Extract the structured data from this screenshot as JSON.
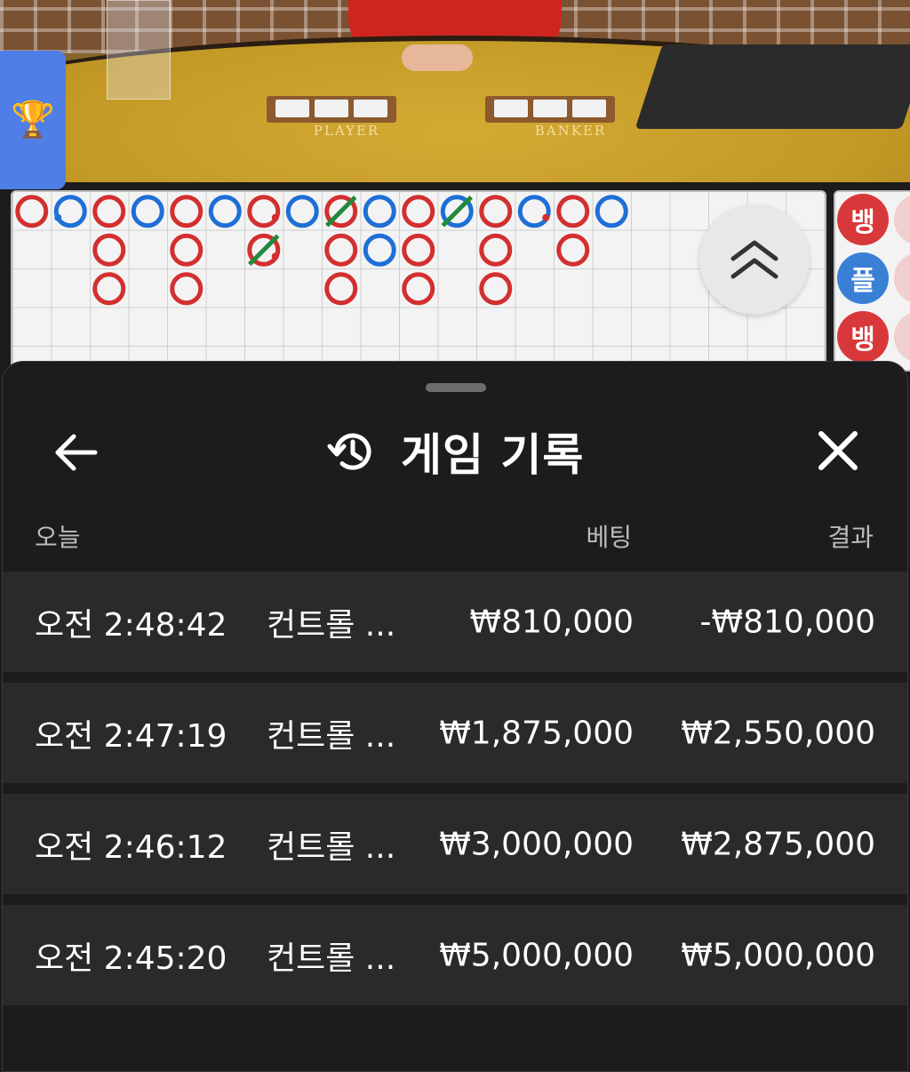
{
  "video": {
    "felt_labels": {
      "player": "PLAYER",
      "banker": "BANKER"
    }
  },
  "scoreboard": {
    "bead_road_labels": [
      "뱅",
      "플",
      "뱅"
    ],
    "colors": {
      "banker": "#d32f2f",
      "player": "#1e6fd6",
      "tie": "#1f8a3b"
    },
    "big_road": [
      {
        "col": 0,
        "row": 0,
        "side": "B"
      },
      {
        "col": 1,
        "row": 0,
        "side": "P",
        "mark": "dot-left"
      },
      {
        "col": 2,
        "row": 0,
        "side": "B"
      },
      {
        "col": 2,
        "row": 1,
        "side": "B"
      },
      {
        "col": 2,
        "row": 2,
        "side": "B"
      },
      {
        "col": 3,
        "row": 0,
        "side": "P"
      },
      {
        "col": 4,
        "row": 0,
        "side": "B"
      },
      {
        "col": 4,
        "row": 1,
        "side": "B"
      },
      {
        "col": 4,
        "row": 2,
        "side": "B"
      },
      {
        "col": 5,
        "row": 0,
        "side": "P"
      },
      {
        "col": 6,
        "row": 0,
        "side": "B",
        "mark": "dot-right"
      },
      {
        "col": 6,
        "row": 1,
        "side": "B",
        "mark": "tie-dot"
      },
      {
        "col": 7,
        "row": 0,
        "side": "P"
      },
      {
        "col": 8,
        "row": 0,
        "side": "B",
        "mark": "tie"
      },
      {
        "col": 8,
        "row": 1,
        "side": "B"
      },
      {
        "col": 8,
        "row": 2,
        "side": "B"
      },
      {
        "col": 9,
        "row": 0,
        "side": "P"
      },
      {
        "col": 9,
        "row": 1,
        "side": "P"
      },
      {
        "col": 10,
        "row": 0,
        "side": "B"
      },
      {
        "col": 10,
        "row": 1,
        "side": "B"
      },
      {
        "col": 10,
        "row": 2,
        "side": "B"
      },
      {
        "col": 11,
        "row": 0,
        "side": "P",
        "mark": "tie"
      },
      {
        "col": 12,
        "row": 0,
        "side": "B"
      },
      {
        "col": 12,
        "row": 1,
        "side": "B"
      },
      {
        "col": 12,
        "row": 2,
        "side": "B"
      },
      {
        "col": 13,
        "row": 0,
        "side": "P",
        "mark": "dot-right"
      },
      {
        "col": 14,
        "row": 0,
        "side": "B"
      },
      {
        "col": 14,
        "row": 1,
        "side": "B"
      },
      {
        "col": 15,
        "row": 0,
        "side": "P"
      }
    ]
  },
  "sheet": {
    "title": "게임 기록",
    "columns": {
      "date": "오늘",
      "bet": "베팅",
      "result": "결과"
    },
    "rows": [
      {
        "time": "오전 2:48:42",
        "game": "컨트롤 ...",
        "bet": "₩810,000",
        "result": "-₩810,000"
      },
      {
        "time": "오전 2:47:19",
        "game": "컨트롤 ...",
        "bet": "₩1,875,000",
        "result": "₩2,550,000"
      },
      {
        "time": "오전 2:46:12",
        "game": "컨트롤 ...",
        "bet": "₩3,000,000",
        "result": "₩2,875,000"
      },
      {
        "time": "오전 2:45:20",
        "game": "컨트롤 ...",
        "bet": "₩5,000,000",
        "result": "₩5,000,000"
      }
    ]
  }
}
